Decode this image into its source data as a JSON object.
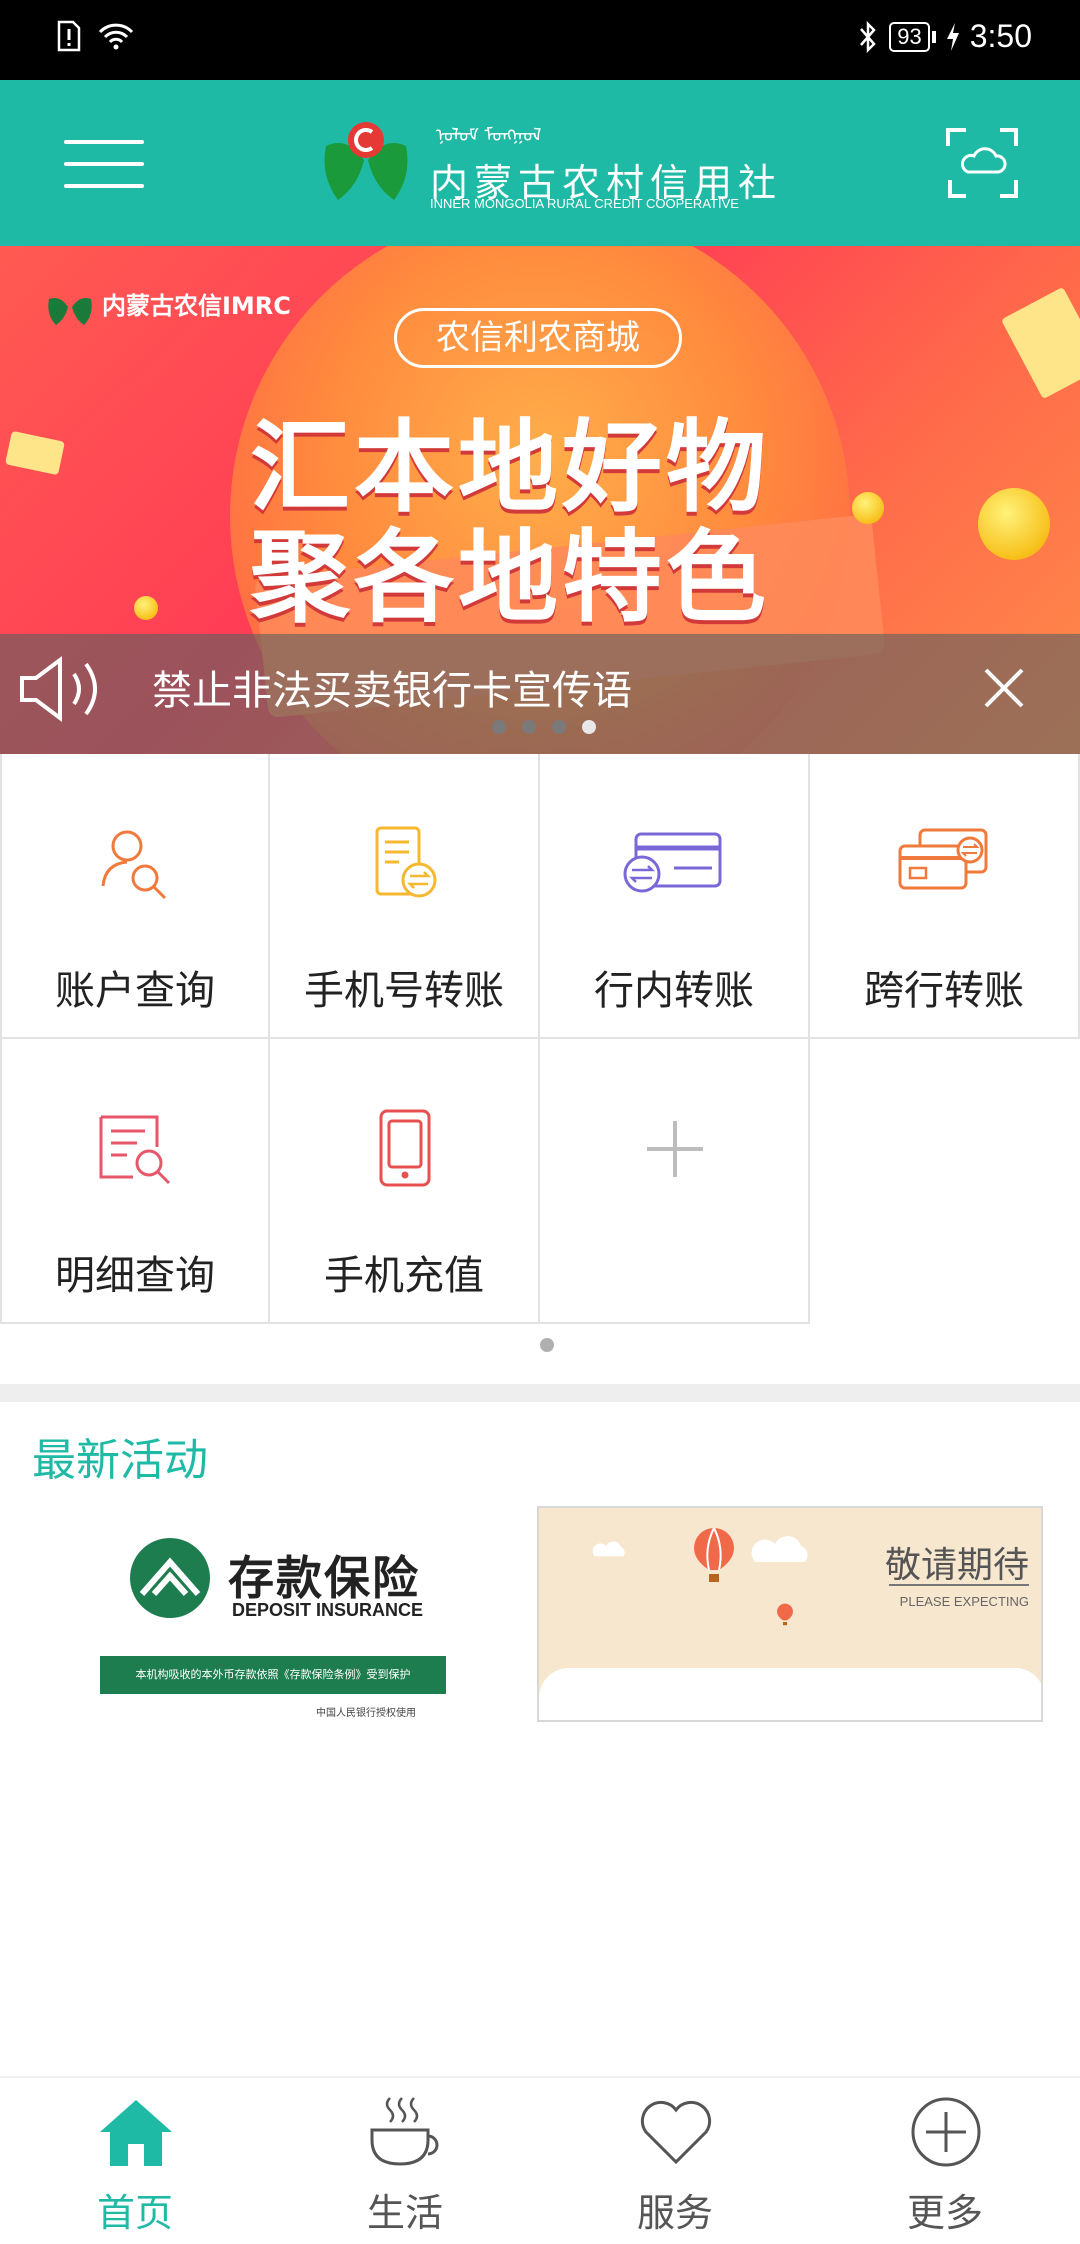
{
  "status_bar": {
    "time": "3:50",
    "battery": "93"
  },
  "header": {
    "logo_cn": "内蒙古农村信用社",
    "logo_en": "INNER MONGOLIA RURAL CREDIT COOPERATIVE"
  },
  "banner": {
    "brand": "内蒙古农信IMRC",
    "pill": "农信利农商城",
    "headline_1": "汇本地好物",
    "headline_2": "聚各地特色",
    "notice": "禁止非法买卖银行卡宣传语",
    "slide_count": 4,
    "active_slide": 4
  },
  "services": [
    {
      "label": "账户查询",
      "icon": "account-search-icon",
      "color": "#f07a3c"
    },
    {
      "label": "手机号转账",
      "icon": "phone-transfer-icon",
      "color": "#f5b82e"
    },
    {
      "label": "行内转账",
      "icon": "internal-transfer-icon",
      "color": "#7b68d8"
    },
    {
      "label": "跨行转账",
      "icon": "interbank-transfer-icon",
      "color": "#f07a3c"
    },
    {
      "label": "明细查询",
      "icon": "detail-search-icon",
      "color": "#e8566a"
    },
    {
      "label": "手机充值",
      "icon": "mobile-recharge-icon",
      "color": "#e85050"
    },
    {
      "label": "",
      "icon": "add-icon",
      "color": "#bdbdbd"
    }
  ],
  "activities": {
    "title": "最新活动",
    "card1": {
      "title": "存款保险",
      "subtitle": "DEPOSIT INSURANCE",
      "bar_text": "本机构吸收的本外币存款依照《存款保险条例》受到保护",
      "footer": "中国人民银行授权使用"
    },
    "card2": {
      "title": "敬请期待",
      "subtitle": "PLEASE EXPECTING"
    }
  },
  "tabs": [
    {
      "label": "首页",
      "icon": "home-icon",
      "active": true
    },
    {
      "label": "生活",
      "icon": "coffee-cup-icon",
      "active": false
    },
    {
      "label": "服务",
      "icon": "heart-icon",
      "active": false
    },
    {
      "label": "更多",
      "icon": "plus-circle-icon",
      "active": false
    }
  ],
  "colors": {
    "brand": "#1fbaa6",
    "tab_inactive": "#555555"
  }
}
